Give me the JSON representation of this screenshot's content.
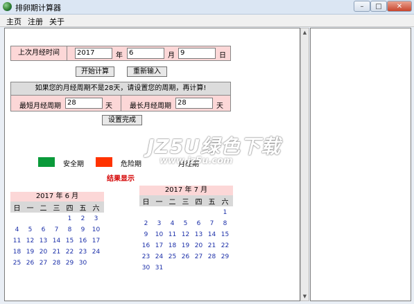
{
  "window": {
    "title": "排卵期计算器",
    "buttons": {
      "minimize": "–",
      "maximize": "□",
      "close": "✕"
    }
  },
  "menu": [
    "主页",
    "注册",
    "关于"
  ],
  "last_period": {
    "label": "上次月经时间",
    "year": "2017",
    "year_unit": "年",
    "month": "6",
    "month_unit": "月",
    "day": "9",
    "day_unit": "日"
  },
  "buttons": {
    "start": "开始计算",
    "reset": "重新输入",
    "done": "设置完成"
  },
  "cycle": {
    "notice": "如果您的月经周期不是28天，请设置您的周期，再计算!",
    "min_label": "最短月经周期",
    "min_value": "28",
    "min_unit": "天",
    "max_label": "最长月经周期",
    "max_value": "28",
    "max_unit": "天"
  },
  "legend": [
    {
      "label": "安全期",
      "color": "#0a9a3a"
    },
    {
      "label": "危险期",
      "color": "#ff3300"
    },
    {
      "label": "月经期",
      "color": ""
    }
  ],
  "result_title": "结果显示",
  "watermark": {
    "line1": "JZ5U绿色下载",
    "line2": "www.jz5u.com"
  },
  "calendars": [
    {
      "title": "2017 年 6 月",
      "weekdays": [
        "日",
        "一",
        "二",
        "三",
        "四",
        "五",
        "六"
      ],
      "weeks": [
        [
          "",
          "",
          "",
          "",
          "1",
          "2",
          "3"
        ],
        [
          "4",
          "5",
          "6",
          "7",
          "8",
          "9",
          "10"
        ],
        [
          "11",
          "12",
          "13",
          "14",
          "15",
          "16",
          "17"
        ],
        [
          "18",
          "19",
          "20",
          "21",
          "22",
          "23",
          "24"
        ],
        [
          "25",
          "26",
          "27",
          "28",
          "29",
          "30",
          ""
        ]
      ]
    },
    {
      "title": "2017 年 7 月",
      "weekdays": [
        "日",
        "一",
        "二",
        "三",
        "四",
        "五",
        "六"
      ],
      "weeks": [
        [
          "",
          "",
          "",
          "",
          "",
          "",
          "1"
        ],
        [
          "2",
          "3",
          "4",
          "5",
          "6",
          "7",
          "8"
        ],
        [
          "9",
          "10",
          "11",
          "12",
          "13",
          "14",
          "15"
        ],
        [
          "16",
          "17",
          "18",
          "19",
          "20",
          "21",
          "22"
        ],
        [
          "23",
          "24",
          "25",
          "26",
          "27",
          "28",
          "29"
        ],
        [
          "30",
          "31",
          "",
          "",
          "",
          "",
          ""
        ]
      ]
    }
  ]
}
